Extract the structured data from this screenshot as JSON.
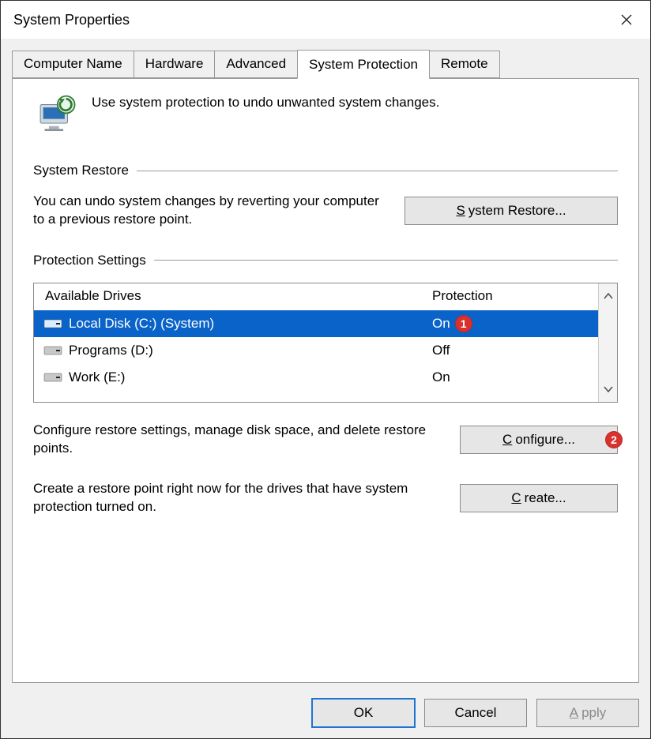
{
  "window": {
    "title": "System Properties"
  },
  "tabs": {
    "computer_name": "Computer Name",
    "hardware": "Hardware",
    "advanced": "Advanced",
    "system_protection": "System Protection",
    "remote": "Remote"
  },
  "intro": {
    "text": "Use system protection to undo unwanted system changes."
  },
  "system_restore": {
    "title": "System Restore",
    "desc": "You can undo system changes by reverting your computer to a previous restore point.",
    "button_prefix": "S",
    "button_rest": "ystem Restore..."
  },
  "protection_settings": {
    "title": "Protection Settings",
    "columns": {
      "drives": "Available Drives",
      "protection": "Protection"
    },
    "rows": [
      {
        "name": "Local Disk (C:) (System)",
        "protection": "On",
        "selected": true,
        "callout": "1"
      },
      {
        "name": "Programs (D:)",
        "protection": "Off",
        "selected": false,
        "callout": ""
      },
      {
        "name": "Work (E:)",
        "protection": "On",
        "selected": false,
        "callout": ""
      }
    ],
    "configure": {
      "desc": "Configure restore settings, manage disk space, and delete restore points.",
      "button_prefix": "C",
      "button_rest": "onfigure...",
      "callout": "2"
    },
    "create": {
      "desc": "Create a restore point right now for the drives that have system protection turned on.",
      "button_prefix": "C",
      "button_rest": "reate..."
    }
  },
  "footer": {
    "ok": "OK",
    "cancel": "Cancel",
    "apply_prefix": "A",
    "apply_rest": "pply"
  }
}
